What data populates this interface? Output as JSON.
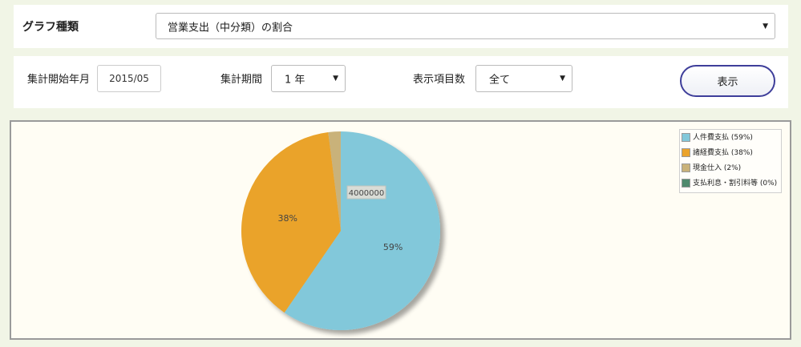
{
  "graph_type": {
    "label": "グラフ種類",
    "selected": "営業支出（中分類）の割合"
  },
  "aggregation": {
    "start_label": "集計開始年月",
    "start_value": "2015/05",
    "period_label": "集計期間",
    "period_value": "1 年",
    "items_label": "表示項目数",
    "items_value": "全て",
    "show_button": "表示"
  },
  "chart_data": {
    "type": "pie",
    "center_label": "4000000",
    "series": [
      {
        "name": "人件費支払",
        "legend": "人件費支払 (59%)",
        "value": 59,
        "label": "59%",
        "color": "#82c8da"
      },
      {
        "name": "諸経費支払",
        "legend": "諸経費支払 (38%)",
        "value": 38,
        "label": "38%",
        "color": "#eaa32b"
      },
      {
        "name": "現金仕入",
        "legend": "現金仕入 (2%)",
        "value": 2,
        "label": "",
        "color": "#c9b27a"
      },
      {
        "name": "支払利息・割引料等",
        "legend": "支払利息・割引料等 (0%)",
        "value": 0,
        "label": "",
        "color": "#4e8a6e"
      }
    ],
    "legend_position": "top-right"
  },
  "colors": {
    "background": "#f1f5e6",
    "chart_background": "#fffdf4",
    "button_border": "#3e3e9a"
  }
}
